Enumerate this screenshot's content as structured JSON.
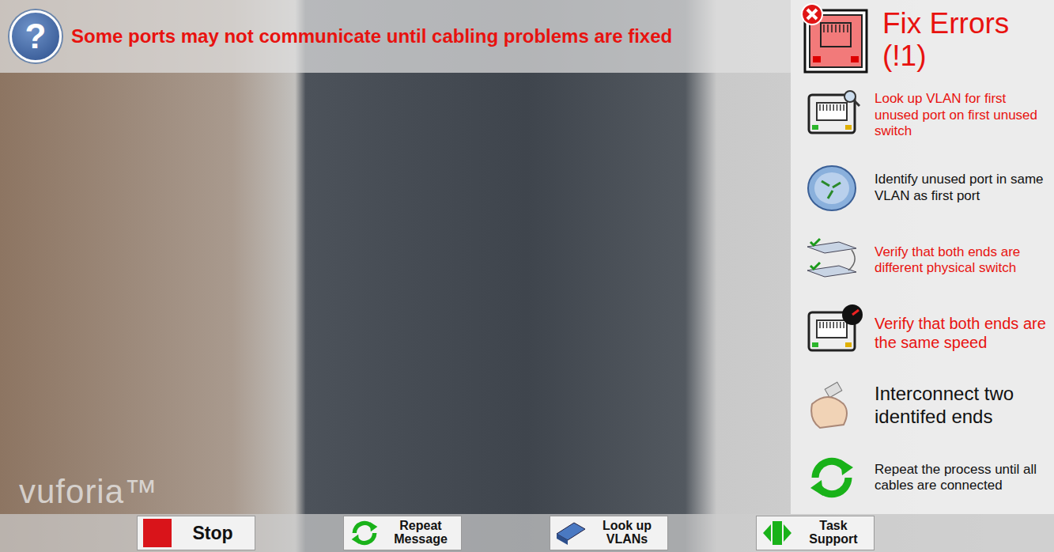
{
  "banner": {
    "help_icon": "?",
    "message": "Some ports may not communicate until cabling problems are fixed"
  },
  "watermark": "vuforia™",
  "panel": {
    "title": "Fix Errors",
    "count": "(!1)",
    "steps": [
      {
        "icon": "lookup",
        "text": "Look up VLAN for first unused port on first unused switch",
        "highlighted": true,
        "kind": "small"
      },
      {
        "icon": "vlan",
        "text": "Identify unused port in same VLAN as first port",
        "highlighted": false,
        "kind": "small"
      },
      {
        "icon": "switches",
        "text": "Verify that both ends are different physical switch",
        "highlighted": true,
        "kind": "small"
      },
      {
        "icon": "speed",
        "text": "Verify that both ends are the same speed",
        "highlighted": true,
        "kind": "medium"
      },
      {
        "icon": "connect",
        "text": "Interconnect two identifed ends",
        "highlighted": false,
        "kind": "large"
      },
      {
        "icon": "repeat",
        "text": "Repeat the process until all cables are connected",
        "highlighted": false,
        "kind": "small"
      }
    ]
  },
  "buttons": [
    {
      "icon": "stop",
      "label": "Stop",
      "kind": "large"
    },
    {
      "icon": "repeat",
      "label": "Repeat Message",
      "kind": "small"
    },
    {
      "icon": "switch",
      "label": "Look up VLANs",
      "kind": "small"
    },
    {
      "icon": "its",
      "label": "Task Support",
      "kind": "small"
    }
  ]
}
